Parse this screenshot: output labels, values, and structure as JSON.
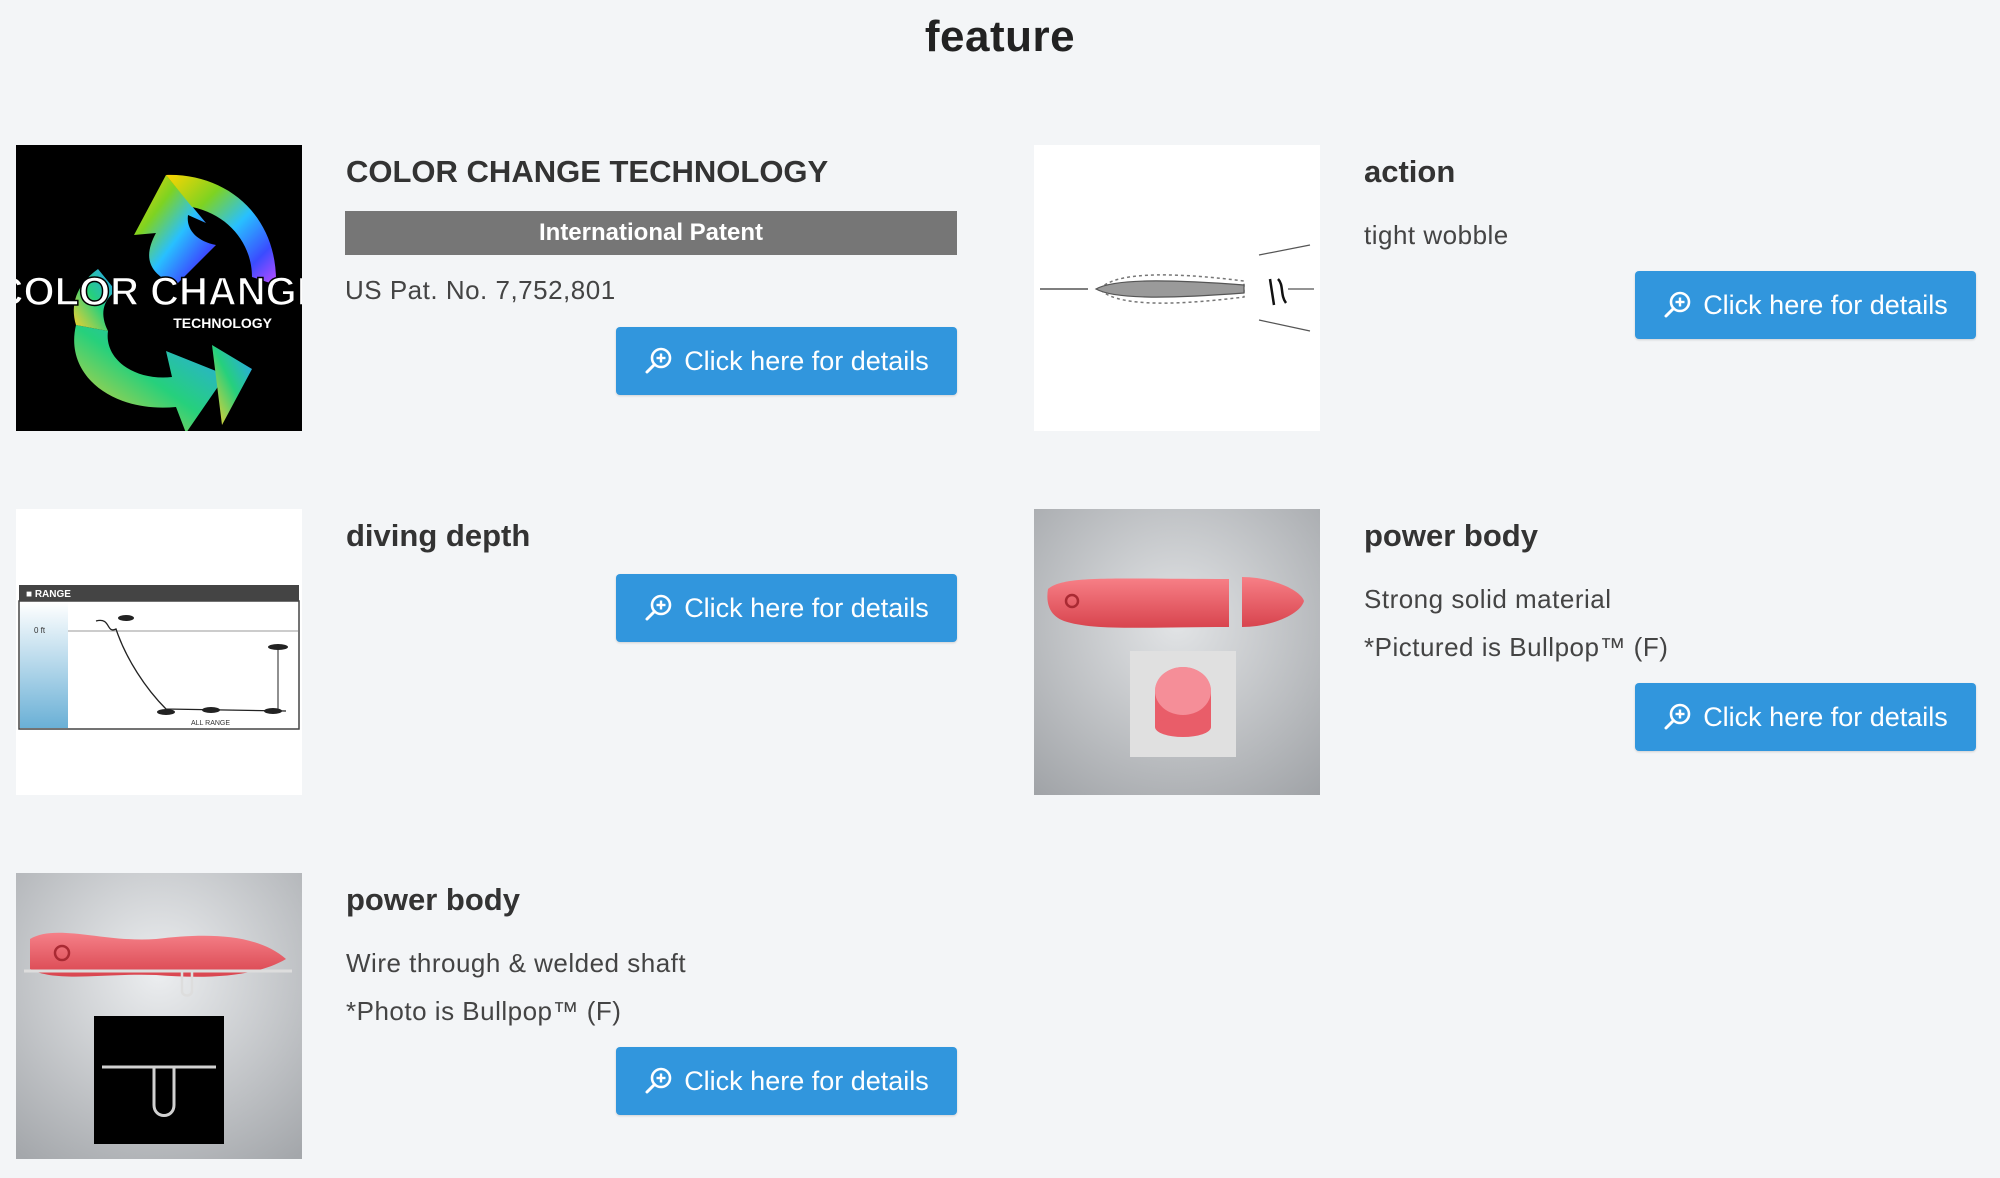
{
  "page": {
    "title": "feature"
  },
  "cards": [
    {
      "heading": "COLOR CHANGE TECHNOLOGY",
      "badge": "International Patent",
      "lines": [
        "US Pat. No. 7,752,801"
      ],
      "button_label": "Click here for details",
      "image_logo_text": [
        "COLOR CHANGE",
        "TECHNOLOGY"
      ]
    },
    {
      "heading": "action",
      "lines": [
        "tight wobble"
      ],
      "button_label": "Click here for details"
    },
    {
      "heading": "diving depth",
      "lines": [],
      "button_label": "Click here for details",
      "image_labels": [
        "■ RANGE",
        "0 ft",
        "ALL RANGE"
      ]
    },
    {
      "heading": "power body",
      "lines": [
        "Strong solid material",
        "*Pictured is Bullpop™ (F)"
      ],
      "button_label": "Click here for details"
    },
    {
      "heading": "power body",
      "lines": [
        "Wire through & welded shaft",
        "*Photo is Bullpop™ (F)"
      ],
      "button_label": "Click here for details"
    }
  ],
  "colors": {
    "button": "#3196dd",
    "badge": "#767676",
    "background": "#f3f5f7"
  },
  "icons": {
    "button_icon": "zoom-in-icon"
  }
}
